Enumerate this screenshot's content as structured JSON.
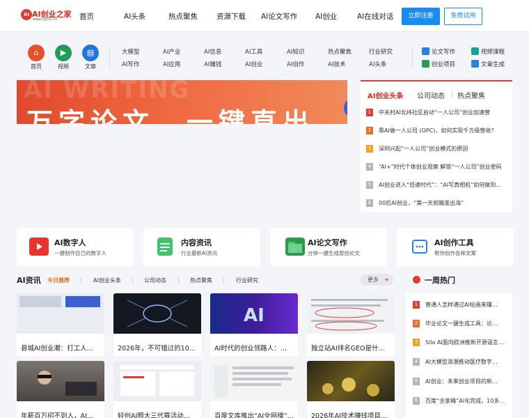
{
  "header": {
    "logo_badge": "AI",
    "logo_name": "AI创业之家",
    "logo_url": "www.cyz11.cn",
    "nav": [
      "首页",
      "AI头条",
      "热点聚焦",
      "资源下载",
      "AI论文写作",
      "AI创业",
      "AI在线对话"
    ],
    "register_label": "立即注册",
    "trial_label": "免费试用"
  },
  "quick": {
    "shortcuts": [
      {
        "label": "首页",
        "icon": "home-icon",
        "color": "#e8502a"
      },
      {
        "label": "视频",
        "icon": "video-icon",
        "color": "#1f9e5a"
      },
      {
        "label": "文章",
        "icon": "book-icon",
        "color": "#2176d9"
      }
    ],
    "categories_row1": [
      "大模型",
      "AI产业",
      "AI信息",
      "AI工具",
      "AI知识",
      "热点聚焦",
      "行业研究"
    ],
    "categories_row2": [
      "AI写作",
      "AI应用",
      "AI赚钱",
      "AI创业",
      "AI创作",
      "AI技术",
      "AI头条"
    ],
    "services": [
      {
        "label": "论文写作",
        "icon": "paper-icon",
        "color": "#2a7fe0"
      },
      {
        "label": "视频课程",
        "icon": "course-icon",
        "color": "#17a59a"
      },
      {
        "label": "创业项目",
        "icon": "project-icon",
        "color": "#2a9d4a"
      },
      {
        "label": "文章生成",
        "icon": "generate-icon",
        "color": "#2a7fe0"
      }
    ]
  },
  "banner": {
    "ghost_text": "AI WRITING",
    "headline": "万字论文，一键直出"
  },
  "headlines": {
    "tabs": [
      "AI创业头条",
      "公司动态",
      "热点聚焦"
    ],
    "items": [
      "中关村AI北纬社区启动“一人公司”创业加速营",
      "靠AI做一人公司 (OPC)，如何实现千万级营收？",
      "深圳兴起“一人公司”创业模式的原因",
      "“AI+”时代个体创业观察 解锁“一人公司”创业密码",
      "AI创业进入“倍速时代”：“AI写真相机”如何做到…",
      "00后AI创业，“第一天就瞄准出海”"
    ],
    "num_colors": [
      "#e23a2e",
      "#f06a26",
      "#f0a020",
      "#b0b4bc",
      "#b0b4bc",
      "#b0b4bc"
    ]
  },
  "features": [
    {
      "title": "AI数字人",
      "subtitle": "一键制作自己的数字人",
      "icon": "digital-human-icon",
      "color": "#e8342a"
    },
    {
      "title": "内容资讯",
      "subtitle": "行业最新AI资讯",
      "icon": "news-icon",
      "color": "#3fc46a"
    },
    {
      "title": "AI论文写作",
      "subtitle": "分钟一键生成原创论文",
      "icon": "folder-icon",
      "color": "#2a9d4a"
    },
    {
      "title": "AI创作工具",
      "subtitle": "帮你创作各种文案",
      "icon": "chat-icon",
      "color": "#2a7fe0"
    }
  ],
  "news": {
    "title": "AI资讯",
    "tabs": [
      "今日推荐",
      "AI创业头条",
      "公司动态",
      "热点聚焦",
      "行业研究"
    ],
    "more_label": "更多",
    "articles": [
      {
        "caption": "县城AI创业潮：打工人…",
        "thumb": "#e9ecf2"
      },
      {
        "caption": "2026年，不可错过的10…",
        "thumb": "#141820"
      },
      {
        "caption": "AI时代的创业领路人：…",
        "thumb": "#1a2a8a"
      },
      {
        "caption": "独立站AI排名GEO是什…",
        "thumb": "#f1f2f4"
      },
      {
        "caption": "年薪百万招不到人，AI…",
        "thumb": "#5a5550"
      },
      {
        "caption": "轻创AI照大三代赛活动…",
        "thumb": "#eceef2"
      },
      {
        "caption": "百度文库推出“AI全网搜”…",
        "thumb": "#f4f4f2"
      },
      {
        "caption": "2026年AI技术赚钱项目…",
        "thumb": "#2a2618"
      }
    ]
  },
  "weekly_hot": {
    "title": "一周热门",
    "items": [
      "普通人怎样通过AI绘画来赚…",
      "毕业论文一键生成工具：论…",
      "Silo AI面向欧洲推新开源语言…",
      "AI大模型浪潮推动医疗数字…",
      "AI创业：未来创业项目的新…",
      "百度“全家桶”AI化完成，10多…"
    ],
    "num_colors": [
      "#e23a2e",
      "#f06a26",
      "#f0a020",
      "#b0b4bc",
      "#b0b4bc",
      "#b0b4bc"
    ]
  }
}
